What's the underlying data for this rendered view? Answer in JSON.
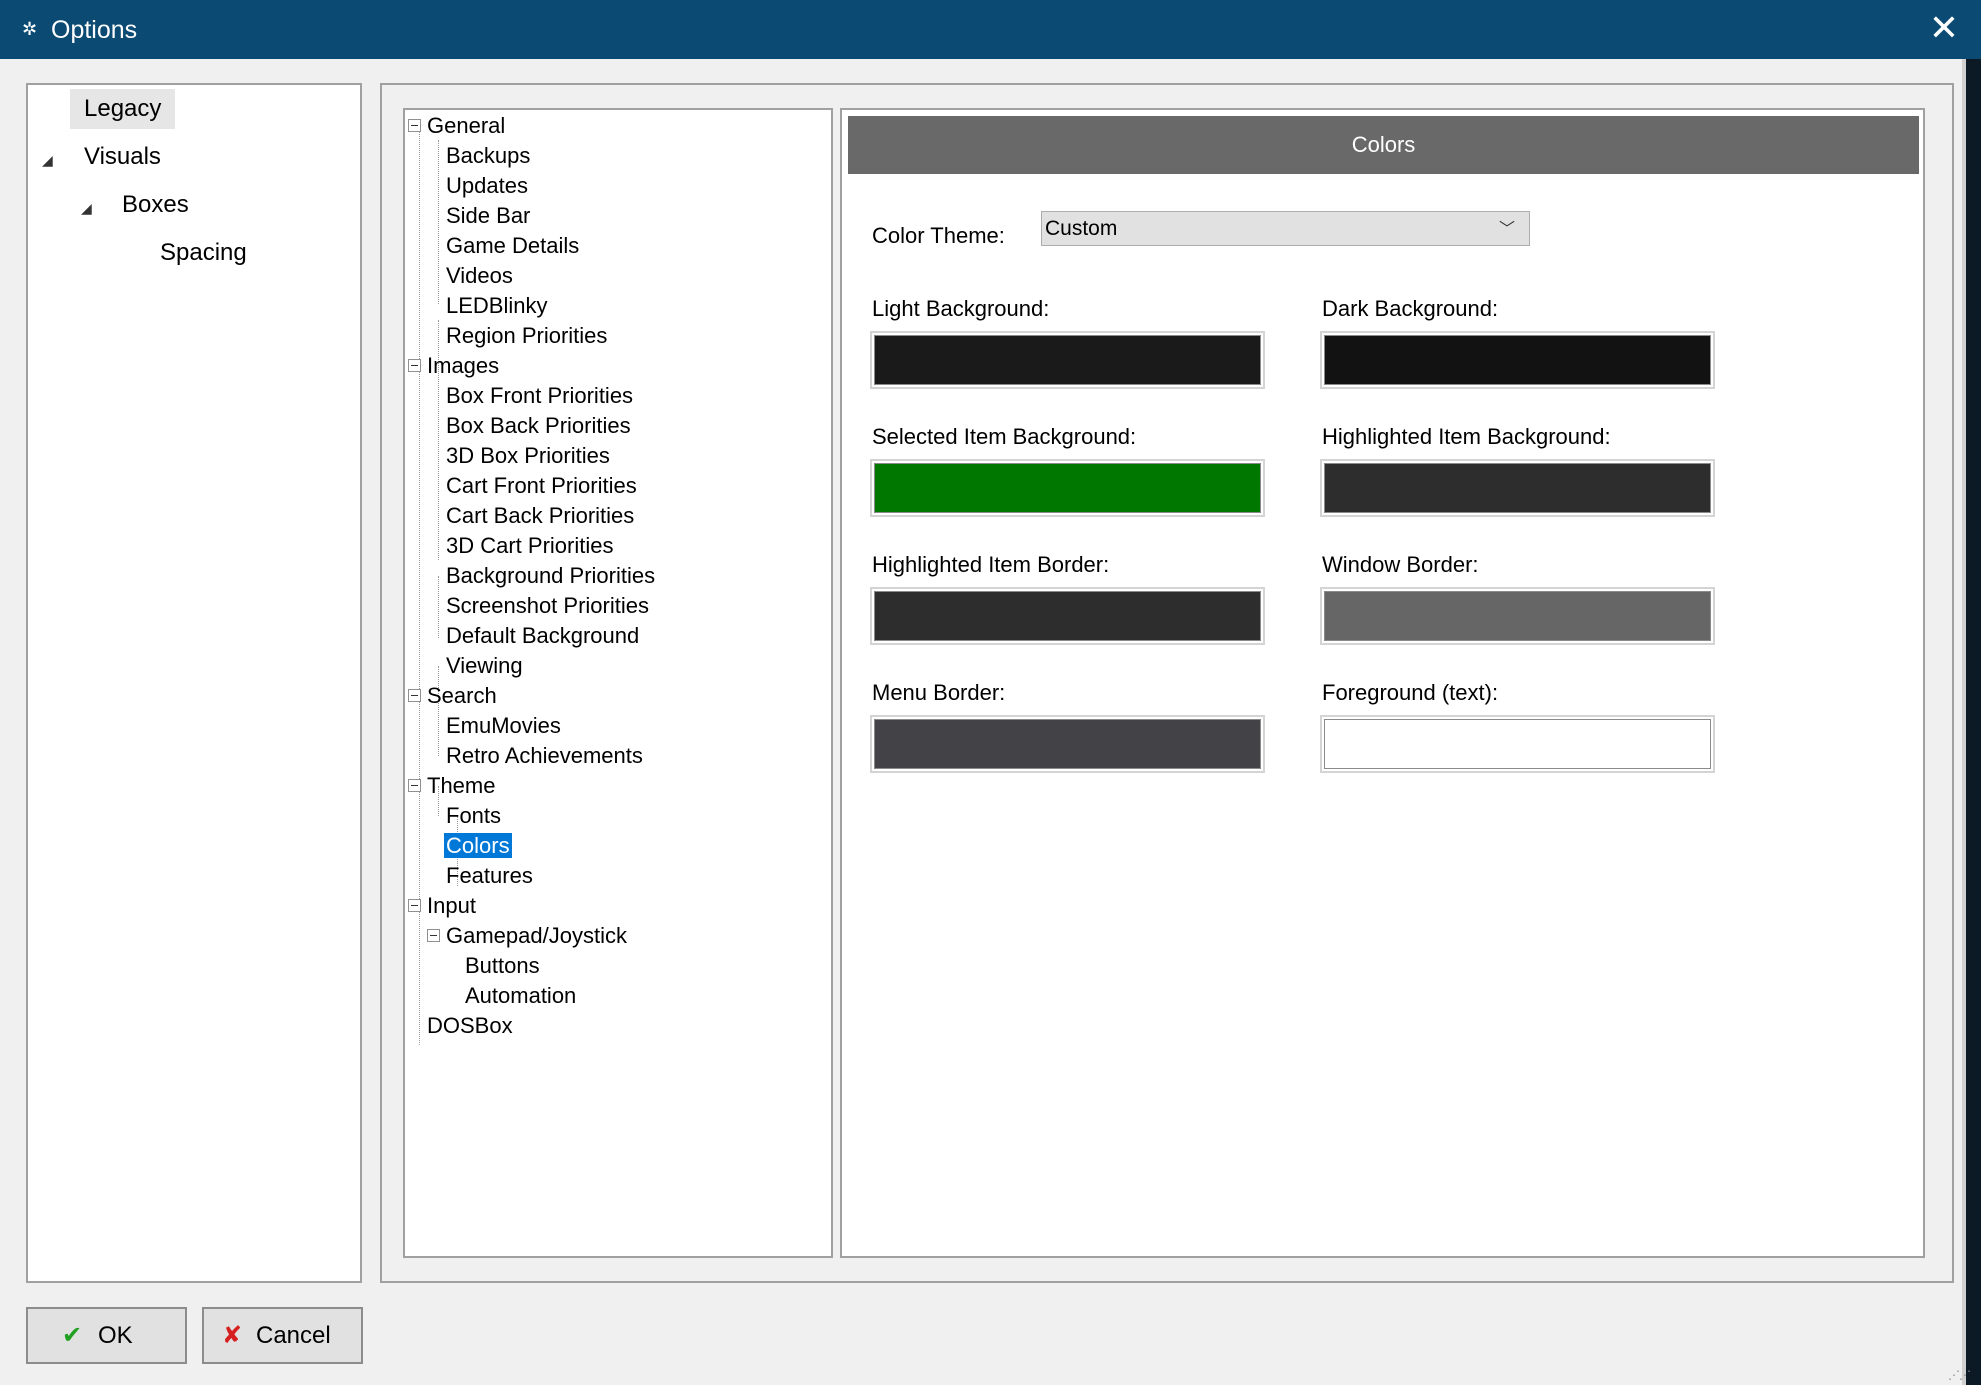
{
  "window": {
    "title": "Options",
    "app_icon": "gear-icon",
    "close_glyph": "✕"
  },
  "left_nav": {
    "items": [
      {
        "label": "Legacy",
        "selected": true
      },
      {
        "label": "Visuals",
        "expanded": true
      },
      {
        "label": "Boxes",
        "expanded": true
      },
      {
        "label": "Spacing"
      }
    ]
  },
  "tree": {
    "general": {
      "label": "General",
      "children": [
        "Backups",
        "Updates",
        "Side Bar",
        "Game Details",
        "Videos",
        "LEDBlinky",
        "Region Priorities"
      ]
    },
    "images": {
      "label": "Images",
      "children": [
        "Box Front Priorities",
        "Box Back Priorities",
        "3D Box Priorities",
        "Cart Front Priorities",
        "Cart Back Priorities",
        "3D Cart Priorities",
        "Background Priorities",
        "Screenshot Priorities",
        "Default Background",
        "Viewing"
      ]
    },
    "search": {
      "label": "Search",
      "children": [
        "EmuMovies",
        "Retro Achievements"
      ]
    },
    "theme": {
      "label": "Theme",
      "children": [
        "Fonts",
        "Colors",
        "Features"
      ]
    },
    "input": {
      "label": "Input",
      "gamepad": {
        "label": "Gamepad/Joystick",
        "children": [
          "Buttons",
          "Automation"
        ]
      }
    },
    "dosbox": {
      "label": "DOSBox"
    },
    "selected": "Colors"
  },
  "settings": {
    "header": "Colors",
    "theme_label": "Color Theme:",
    "theme_value": "Custom",
    "colors": {
      "light_bg": {
        "label": "Light Background:",
        "hex": "#1a1a1a"
      },
      "dark_bg": {
        "label": "Dark Background:",
        "hex": "#121212"
      },
      "selected_item_bg": {
        "label": "Selected Item Background:",
        "hex": "#007800"
      },
      "highlighted_item_bg": {
        "label": "Highlighted Item Background:",
        "hex": "#2d2d2d"
      },
      "highlighted_item_border": {
        "label": "Highlighted Item Border:",
        "hex": "#2d2d2d"
      },
      "window_border": {
        "label": "Window Border:",
        "hex": "#666666"
      },
      "menu_border": {
        "label": "Menu Border:",
        "hex": "#434347"
      },
      "foreground_text": {
        "label": "Foreground (text):",
        "hex": "#ffffff"
      }
    }
  },
  "footer": {
    "ok_label": "OK",
    "ok_icon": "checkmark-icon",
    "cancel_label": "Cancel",
    "cancel_icon": "x-icon"
  }
}
